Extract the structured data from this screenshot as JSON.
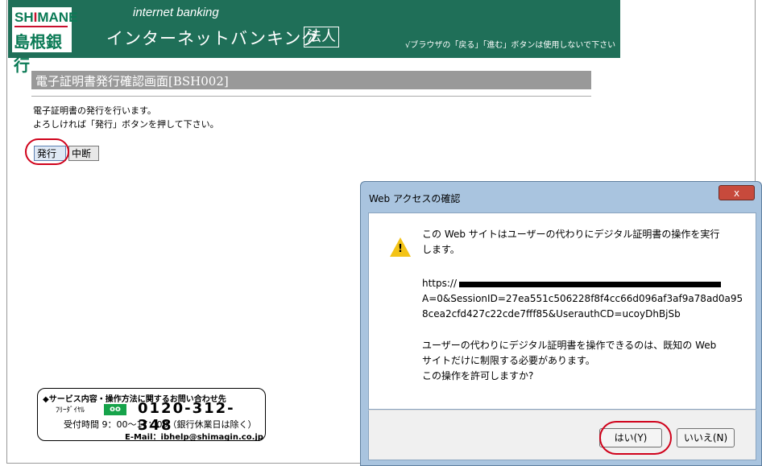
{
  "header": {
    "logo_en_prefix": "SH",
    "logo_en_i": "I",
    "logo_en_suffix": "MANE",
    "logo_jp": "島根銀行",
    "service_en": "internet banking",
    "service_jp": "インターネットバンキング",
    "corporate_badge": "法人",
    "browser_note": "√ブラウザの「戻る」「進む」ボタンは使用しないで下さい"
  },
  "page": {
    "title": "電子証明書発行確認画面[BSH002]",
    "message_line1": "電子証明書の発行を行います。",
    "message_line2": "よろしければ「発行」ボタンを押して下さい。",
    "issue_button": "発行",
    "cancel_button": "中断"
  },
  "contact": {
    "heading": "◆サービス内容・操作方法に関するお問い合わせ先",
    "freedial_label": "ﾌﾘｰﾀﾞｲﾔﾙ",
    "freedial_icon": "oo",
    "phone": "0120-312-348",
    "hours": "受付時間 9：00～17：00（銀行休業日は除く）",
    "email": "E-Mail：ibhelp@shimagin.co.jp"
  },
  "dialog": {
    "title": "Web アクセスの確認",
    "close_label": "x",
    "line1": "この Web サイトはユーザーの代わりにデジタル証明書の操作を実行",
    "line2": "します。",
    "url_prefix": "https://",
    "url_line2": "A=0&SessionID=27ea551c506228f8f4cc66d096af3af9a78ad0a95",
    "url_line3": "8cea2cfd427c22cde7fff85&UserauthCD=ucoyDhBjSb",
    "line3": "ユーザーの代わりにデジタル証明書を操作できるのは、既知の Web",
    "line4": "サイトだけに制限する必要があります。",
    "line5": "この操作を許可しますか?",
    "yes_button": "はい(Y)",
    "no_button": "いいえ(N)"
  },
  "colors": {
    "header_green": "#1f6f58",
    "highlight_red": "#d0021b",
    "title_bar_gray": "#999999"
  }
}
